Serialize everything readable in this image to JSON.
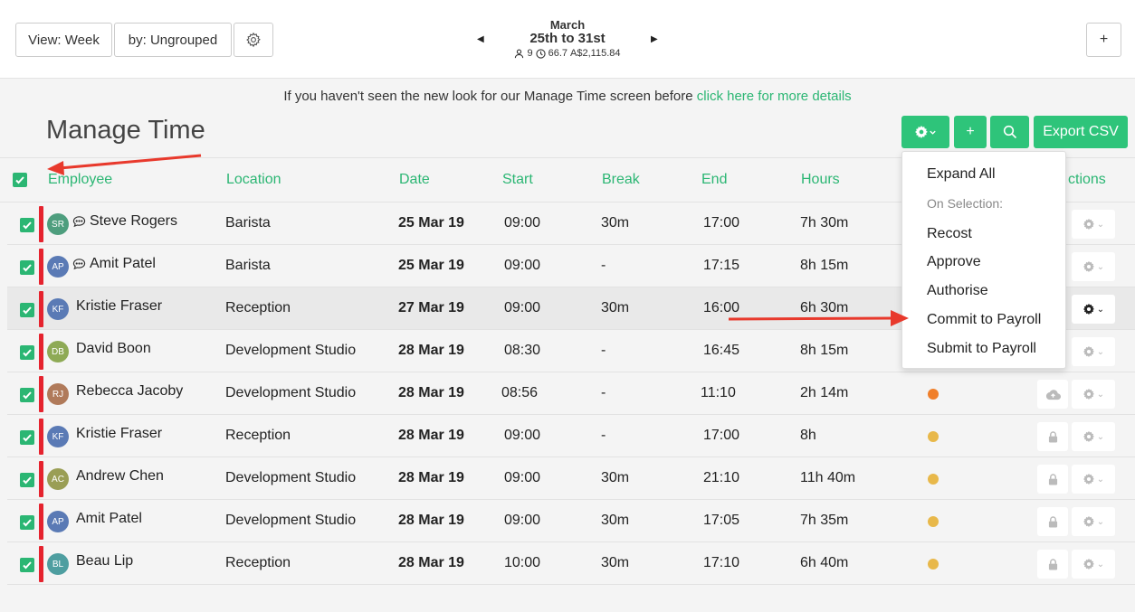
{
  "toolbar": {
    "view_label": "View: Week",
    "group_label": "by: Ungrouped",
    "add_label": "+"
  },
  "week": {
    "month": "March",
    "range": "25th to 31st",
    "staff_count": "9",
    "hours": "66.7",
    "cost": "A$2,115.84"
  },
  "notice": {
    "text": "If you haven't seen the new look for our Manage Time screen before ",
    "link": "click here for more details"
  },
  "page_title": "Manage Time",
  "actions": {
    "add_label": "+",
    "export_label": "Export CSV"
  },
  "columns": {
    "employee": "Employee",
    "location": "Location",
    "date": "Date",
    "start": "Start",
    "break": "Break",
    "end": "End",
    "hours": "Hours",
    "actions": "ctions"
  },
  "dropdown": {
    "expand_all": "Expand All",
    "on_selection": "On Selection:",
    "recost": "Recost",
    "approve": "Approve",
    "authorise": "Authorise",
    "commit": "Commit to Payroll",
    "submit": "Submit to Payroll"
  },
  "rows": [
    {
      "initials": "SR",
      "avatar_color": "#4e9e7e",
      "name": "Steve Rogers",
      "comment": true,
      "location": "Barista",
      "date": "25 Mar 19",
      "start": "09:00",
      "break": "30m",
      "end": "17:00",
      "hours": "7h 30m",
      "status_color": "",
      "lock": ""
    },
    {
      "initials": "AP",
      "avatar_color": "#5a7ab5",
      "name": "Amit Patel",
      "comment": true,
      "location": "Barista",
      "date": "25 Mar 19",
      "start": "09:00",
      "break": "-",
      "end": "17:15",
      "hours": "8h 15m",
      "status_color": "",
      "lock": ""
    },
    {
      "initials": "KF",
      "avatar_color": "#5a7ab5",
      "name": "Kristie Fraser",
      "comment": false,
      "location": "Reception",
      "date": "27 Mar 19",
      "start": "09:00",
      "break": "30m",
      "end": "16:00",
      "hours": "6h 30m",
      "status_color": "",
      "lock": ""
    },
    {
      "initials": "DB",
      "avatar_color": "#8eaa55",
      "name": "David Boon",
      "comment": false,
      "location": "Development Studio",
      "date": "28 Mar 19",
      "start": "08:30",
      "break": "-",
      "end": "16:45",
      "hours": "8h 15m",
      "status_color": "",
      "lock": ""
    },
    {
      "initials": "RJ",
      "avatar_color": "#b07a5a",
      "name": "Rebecca Jacoby",
      "comment": false,
      "location": "Development Studio",
      "date": "28 Mar 19",
      "start": "08:56",
      "break": "-",
      "end": "11:10",
      "hours": "2h 14m",
      "status_color": "#f07f2a",
      "lock": "cloud"
    },
    {
      "initials": "KF",
      "avatar_color": "#5a7ab5",
      "name": "Kristie Fraser",
      "comment": false,
      "location": "Reception",
      "date": "28 Mar 19",
      "start": "09:00",
      "break": "-",
      "end": "17:00",
      "hours": "8h",
      "status_color": "#e8b84a",
      "lock": "lock"
    },
    {
      "initials": "AC",
      "avatar_color": "#9a9e55",
      "name": "Andrew Chen",
      "comment": false,
      "location": "Development Studio",
      "date": "28 Mar 19",
      "start": "09:00",
      "break": "30m",
      "end": "21:10",
      "hours": "11h 40m",
      "status_color": "#e8b84a",
      "lock": "lock"
    },
    {
      "initials": "AP",
      "avatar_color": "#5a7ab5",
      "name": "Amit Patel",
      "comment": false,
      "location": "Development Studio",
      "date": "28 Mar 19",
      "start": "09:00",
      "break": "30m",
      "end": "17:05",
      "hours": "7h 35m",
      "status_color": "#e8b84a",
      "lock": "lock"
    },
    {
      "initials": "BL",
      "avatar_color": "#4e9ea0",
      "name": "Beau Lip",
      "comment": false,
      "location": "Reception",
      "date": "28 Mar 19",
      "start": "10:00",
      "break": "30m",
      "end": "17:10",
      "hours": "6h 40m",
      "status_color": "#e8b84a",
      "lock": "lock"
    }
  ]
}
